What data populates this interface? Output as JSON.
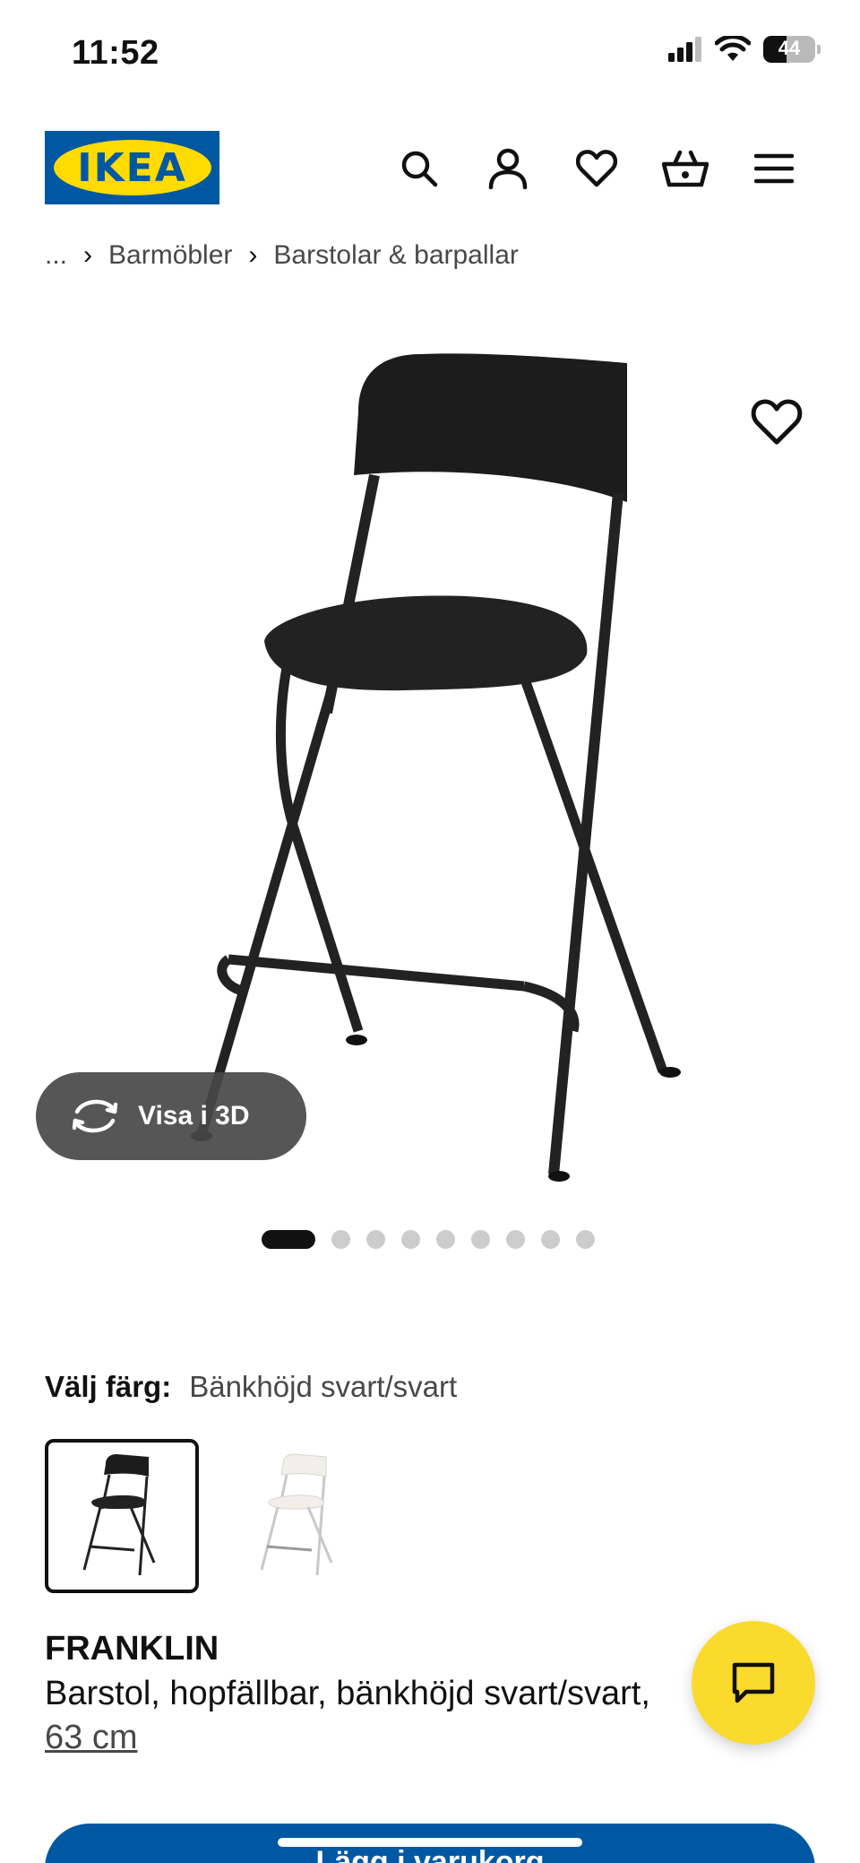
{
  "status_bar": {
    "time": "11:52",
    "battery": "44",
    "battery_level": 0.44
  },
  "header": {
    "logo_text": "IKEA",
    "icons": [
      "search-icon",
      "account-icon",
      "heart-icon",
      "basket-icon",
      "menu-icon"
    ]
  },
  "breadcrumb": {
    "ellipsis": "...",
    "items": [
      "Barmöbler",
      "Barstolar & barpallar"
    ]
  },
  "gallery": {
    "view_3d_label": "Visa i 3D",
    "image_count": 9,
    "active_index": 0
  },
  "color_chooser": {
    "label": "Välj färg:",
    "selected_value": "Bänkhöjd svart/svart",
    "options": [
      "black",
      "white"
    ]
  },
  "product": {
    "name": "FRANKLIN",
    "description": "Barstol, hopfällbar, bänkhöjd svart/svart,",
    "size": "63 cm"
  },
  "cta": {
    "label": "Lägg i varukorg"
  },
  "colors": {
    "ikea_blue": "#0058a3",
    "ikea_yellow": "#ffdb00",
    "chat_yellow": "#fada2c"
  }
}
